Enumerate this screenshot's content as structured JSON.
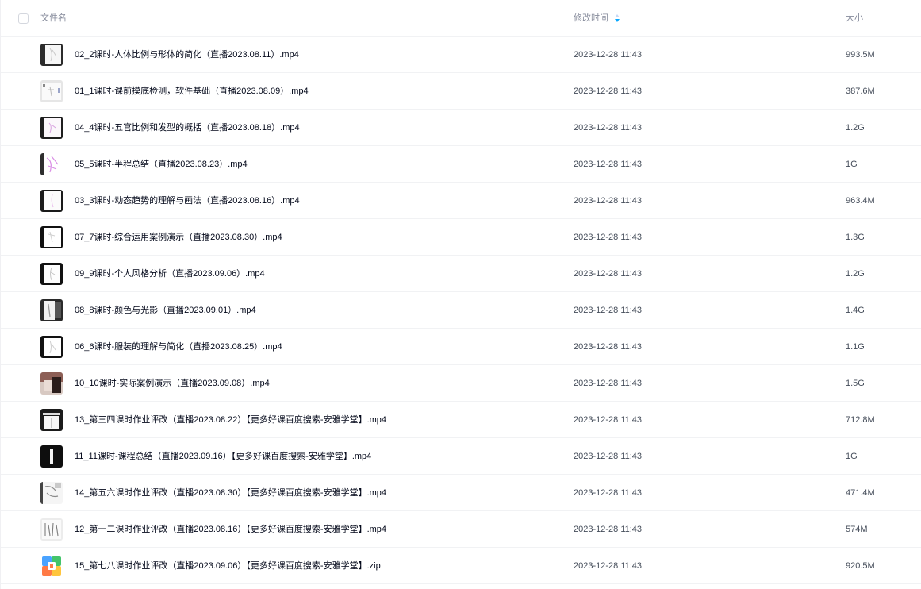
{
  "header": {
    "name_label": "文件名",
    "time_label": "修改时间",
    "size_label": "大小"
  },
  "files": [
    {
      "name": "02_2课时-人体比例与形体的简化（直播2023.08.11）.mp4",
      "time": "2023-12-28 11:43",
      "size": "993.5M",
      "thumb": "video-thumbnail-icon"
    },
    {
      "name": "01_1课时-课前摸底检测，软件基础（直播2023.08.09）.mp4",
      "time": "2023-12-28 11:43",
      "size": "387.6M",
      "thumb": "video-thumbnail-icon"
    },
    {
      "name": "04_4课时-五官比例和发型的概括（直播2023.08.18）.mp4",
      "time": "2023-12-28 11:43",
      "size": "1.2G",
      "thumb": "video-thumbnail-icon"
    },
    {
      "name": "05_5课时-半程总结（直播2023.08.23）.mp4",
      "time": "2023-12-28 11:43",
      "size": "1G",
      "thumb": "video-thumbnail-icon"
    },
    {
      "name": "03_3课时-动态趋势的理解与画法（直播2023.08.16）.mp4",
      "time": "2023-12-28 11:43",
      "size": "963.4M",
      "thumb": "video-thumbnail-icon"
    },
    {
      "name": "07_7课时-综合运用案例演示（直播2023.08.30）.mp4",
      "time": "2023-12-28 11:43",
      "size": "1.3G",
      "thumb": "video-thumbnail-icon"
    },
    {
      "name": "09_9课时-个人风格分析（直播2023.09.06）.mp4",
      "time": "2023-12-28 11:43",
      "size": "1.2G",
      "thumb": "video-thumbnail-icon"
    },
    {
      "name": "08_8课时-颜色与光影（直播2023.09.01）.mp4",
      "time": "2023-12-28 11:43",
      "size": "1.4G",
      "thumb": "video-thumbnail-icon"
    },
    {
      "name": "06_6课时-服装的理解与简化（直播2023.08.25）.mp4",
      "time": "2023-12-28 11:43",
      "size": "1.1G",
      "thumb": "video-thumbnail-icon"
    },
    {
      "name": "10_10课时-实际案例演示（直播2023.09.08）.mp4",
      "time": "2023-12-28 11:43",
      "size": "1.5G",
      "thumb": "video-thumbnail-icon"
    },
    {
      "name": "13_第三四课时作业评改（直播2023.08.22）【更多好课百度搜索-安雅学堂】.mp4",
      "time": "2023-12-28 11:43",
      "size": "712.8M",
      "thumb": "video-thumbnail-icon"
    },
    {
      "name": "11_11课时-课程总结（直播2023.09.16）【更多好课百度搜索-安雅学堂】.mp4",
      "time": "2023-12-28 11:43",
      "size": "1G",
      "thumb": "video-thumbnail-icon"
    },
    {
      "name": "14_第五六课时作业评改（直播2023.08.30）【更多好课百度搜索-安雅学堂】.mp4",
      "time": "2023-12-28 11:43",
      "size": "471.4M",
      "thumb": "video-thumbnail-icon"
    },
    {
      "name": "12_第一二课时作业评改（直播2023.08.16）【更多好课百度搜索-安雅学堂】.mp4",
      "time": "2023-12-28 11:43",
      "size": "574M",
      "thumb": "video-thumbnail-icon"
    },
    {
      "name": "15_第七八课时作业评改（直播2023.09.06）【更多好课百度搜索-安雅学堂】.zip",
      "time": "2023-12-28 11:43",
      "size": "920.5M",
      "thumb": "zip-archive-icon"
    }
  ],
  "colors": {
    "text_primary": "#03081a",
    "text_secondary": "#454d5a",
    "header_text": "#878c9c",
    "divider": "#f1f2f4",
    "sort_accent": "#06a7ff"
  }
}
